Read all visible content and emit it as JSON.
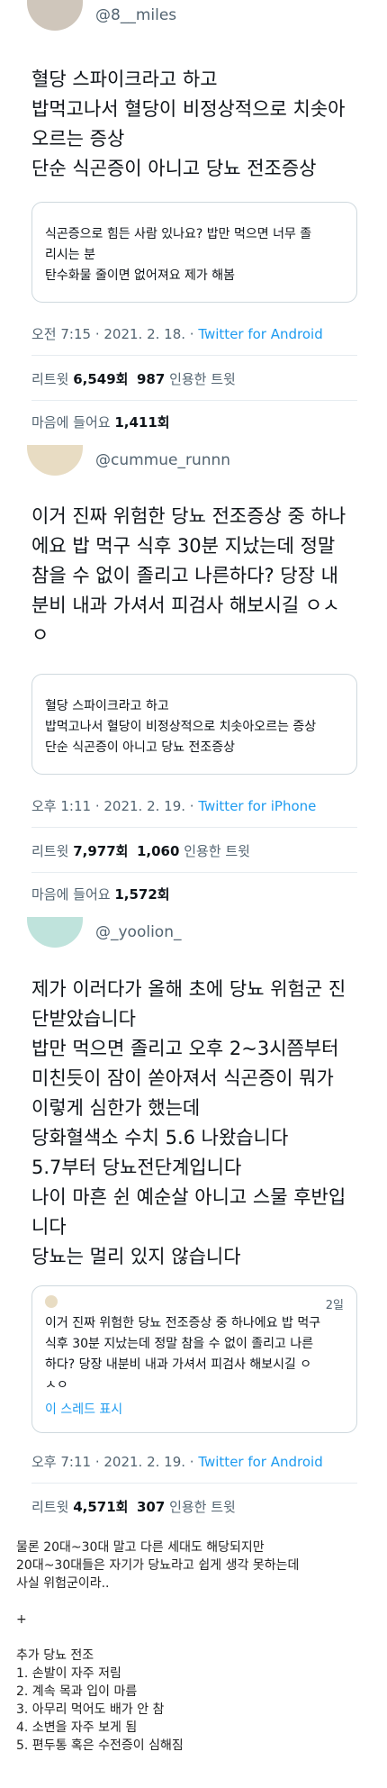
{
  "tweet1": {
    "handle": "@8__miles",
    "body": [
      "혈당 스파이크라고 하고",
      "밥먹고나서 혈당이 비정상적으로 치솟아",
      "오르는 증상",
      "단순 식곤증이 아니고 당뇨 전조증상"
    ],
    "quote": [
      "식곤증으로 힘든 사람 있나요? 밥만 먹으면 너무 졸",
      "리시는 분",
      "탄수화물 줄이면 없어져요 제가 해봄"
    ],
    "time": "오전 7:15 · 2021. 2. 18. · ",
    "source": "Twitter for Android",
    "retweets_label": "리트윗",
    "retweets": "6,549회",
    "quotes": "987",
    "quotes_label": "인용한 트윗",
    "likes_label": "마음에 들어요",
    "likes": "1,411회"
  },
  "tweet2": {
    "handle": "@cummue_runnn",
    "body": [
      "이거 진짜 위험한 당뇨 전조증상 중 하나",
      "에요 밥 먹구 식후 30분 지났는데 정말",
      "참을 수 없이 졸리고 나른하다? 당장 내",
      "분비 내과 가셔서 피검사 해보시길 ㅇㅅ",
      "ㅇ"
    ],
    "quote": [
      "혈당 스파이크라고 하고",
      "밥먹고나서 혈당이 비정상적으로 치솟아오르는 증상",
      "단순 식곤증이 아니고 당뇨 전조증상"
    ],
    "time": "오후 1:11 · 2021. 2. 19. · ",
    "source": "Twitter for iPhone",
    "retweets_label": "리트윗",
    "retweets": "7,977회",
    "quotes": "1,060",
    "quotes_label": "인용한 트윗",
    "likes_label": "마음에 들어요",
    "likes": "1,572회"
  },
  "tweet3": {
    "handle": "@_yoolion_",
    "body": [
      "제가 이러다가 올해 초에 당뇨 위험군 진",
      "단받았습니다",
      "밥만 먹으면 졸리고 오후 2~3시쯤부터",
      "미친듯이 잠이 쏟아져서 식곤증이 뭐가",
      "이렇게 심한가 했는데",
      "당화혈색소 수치 5.6 나왔습니다",
      "5.7부터 당뇨전단계입니다",
      "나이 마흔 쉰 예순살 아니고 스물 후반입",
      "니다",
      "당뇨는 멀리 있지 않습니다"
    ],
    "quote_date": "2일",
    "quote": [
      "이거 진짜 위험한 당뇨 전조증상 중 하나에요 밥 먹구",
      "식후 30분 지났는데 정말 참을 수 없이 졸리고 나른",
      "하다? 당장 내분비 내과 가셔서 피검사 해보시길 ㅇ",
      "ㅅㅇ"
    ],
    "thread_link": "이 스레드 표시",
    "time": "오후 7:11 · 2021. 2. 19. · ",
    "source": "Twitter for Android",
    "retweets_label": "리트윗",
    "retweets": "4,571회",
    "quotes": "307",
    "quotes_label": "인용한 트윗"
  },
  "footer": {
    "lines": [
      "물론 20대~30대 말고 다른 세대도 해당되지만",
      "20대~30대들은 자기가 당뇨라고 쉽게 생각 못하는데",
      "사실 위험군이라..",
      "",
      "+",
      "",
      "추가 당뇨 전조",
      "1. 손발이 자주 저림",
      "2. 계속 목과 입이 마름",
      "3. 아무리 먹어도 배가 안 참",
      "4. 소변을 자주 보게 됨",
      "5. 편두통 혹은 수전증이 심해짐"
    ]
  }
}
